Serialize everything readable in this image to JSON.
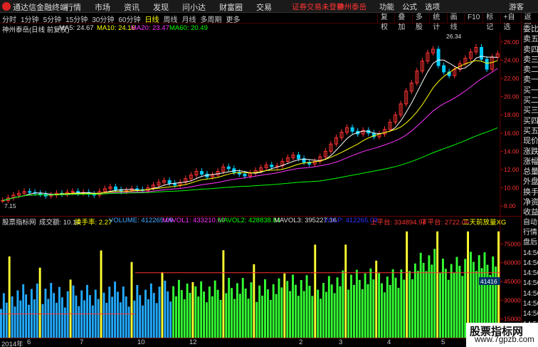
{
  "app": {
    "title": "通达信金融终端",
    "menu": [
      "行情",
      "市场",
      "资讯",
      "发现",
      "问小达",
      "财富圈",
      "交易"
    ],
    "login_notice": "证券交易未登录",
    "stock_name_red": "神州泰岳",
    "right_menu": [
      "功能",
      "公式",
      "选项"
    ],
    "guest": "游客"
  },
  "periodbar": {
    "periods": [
      "分时",
      "1分钟",
      "5分钟",
      "15分钟",
      "30分钟",
      "60分钟",
      "日线",
      "周线",
      "月线",
      "多周期",
      "更多"
    ],
    "active": "日线",
    "tools": [
      "复权",
      "叠加",
      "多股",
      "统计",
      "画线",
      "F10",
      "标记",
      "+自选",
      "返回"
    ]
  },
  "main_chart": {
    "stock_label": "神州泰岳(日线 前复权)",
    "ma5": "MA5: 24.67",
    "ma10": "MA10: 24.16",
    "ma20": "MA20: 23.47",
    "ma60": "MA60: 20.49",
    "high_label": "26.34",
    "low_label": "7.15",
    "y_ticks": [
      "26.00",
      "24.00",
      "22.00",
      "20.00",
      "18.00",
      "16.00",
      "14.00",
      "12.00",
      "10.00",
      "8.00"
    ]
  },
  "indicator": {
    "name": "股票指标网",
    "vol_count": "成交额: 10.14",
    "turnover": "换手率: 2.27",
    "volume": "VOLUME: 412265.09",
    "mavol1": "MAVOL1: 433210.69",
    "mavol2": "MAVOL2: 428838.84",
    "mavol3": "MAVOL3: 395227.16",
    "volp": "VOLP: 412265.09",
    "upper": "上平台: 334894.94",
    "lower": "下平台: 2722.06",
    "extra": "二天前放量XG",
    "y_ticks": [
      "75000",
      "60000",
      "45000",
      "30000",
      "15000"
    ],
    "current_tag": "41416"
  },
  "dates": [
    "2014年",
    "6",
    "7",
    "10",
    "12",
    "2",
    "3",
    "4",
    "5"
  ],
  "side_column": [
    "委比",
    "卖五",
    "卖四",
    "卖三",
    "卖二",
    "卖一",
    "买一",
    "买二",
    "买三",
    "买四",
    "买五",
    "现价",
    "涨跌",
    "涨幅",
    "总量",
    "外盘",
    "换手",
    "净资",
    "收益",
    "自动",
    "行情",
    "盘后",
    "14:56",
    "14:56",
    "14:56",
    "14:56",
    "14:56",
    "14:56",
    "14:56",
    "14:56"
  ],
  "watermark": {
    "line1": "股票指标网",
    "line2": "www.7gpzb.com"
  },
  "chart_data": {
    "type": "line",
    "y_range": [
      7,
      27
    ],
    "price": [
      8.6,
      8.9,
      9.2,
      9.4,
      9.6,
      9.5,
      9.4,
      9.3,
      9.1,
      9.2,
      9.4,
      9.3,
      9.5,
      9.6,
      9.4,
      9.5,
      9.3,
      9.2,
      9.6,
      9.9,
      10.1,
      9.8,
      9.6,
      9.7,
      9.9,
      9.8,
      9.7,
      10.0,
      10.3,
      10.6,
      10.8,
      10.5,
      10.3,
      10.6,
      11.0,
      11.4,
      11.8,
      11.5,
      11.2,
      11.4,
      11.8,
      12.3,
      12.1,
      11.7,
      11.5,
      11.3,
      11.6,
      11.9,
      12.2,
      12.5,
      12.3,
      12.4,
      12.9,
      13.3,
      13.6,
      13.2,
      12.8,
      12.6,
      12.9,
      13.4,
      14.0,
      14.8,
      15.5,
      16.1,
      16.6,
      16.2,
      15.9,
      16.3,
      16.0,
      15.6,
      15.9,
      16.4,
      17.2,
      18.0,
      19.2,
      20.6,
      21.5,
      22.8,
      23.9,
      24.8,
      25.2,
      23.4,
      22.7,
      22.3,
      23.0,
      23.6,
      24.2,
      24.9,
      25.4,
      24.1,
      23.0,
      24.3,
      24.7
    ]
  }
}
